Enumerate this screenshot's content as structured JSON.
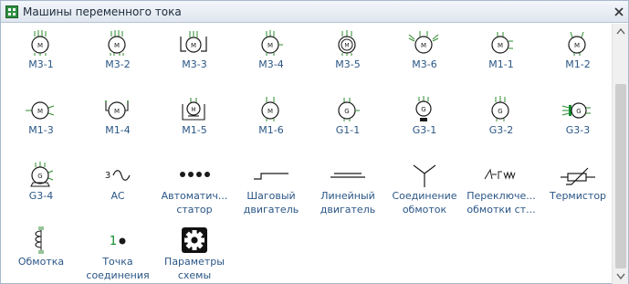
{
  "window": {
    "title": "Машины переменного тока"
  },
  "icons": {
    "title": "stencil-grid-icon",
    "close": "close-x-icon"
  },
  "colors": {
    "label": "#2a5686",
    "symbol_line": "#1a1a1a",
    "symbol_terminal": "#2e8b2e",
    "symbol_accent": "#0a8a2a"
  },
  "items": [
    {
      "label": "M3-1",
      "icon": "motor-3phase-icon"
    },
    {
      "label": "M3-2",
      "icon": "motor-3phase-icon"
    },
    {
      "label": "M3-3",
      "icon": "motor-3phase-brushes-icon"
    },
    {
      "label": "M3-4",
      "icon": "motor-3phase-icon"
    },
    {
      "label": "M3-5",
      "icon": "motor-3phase-icon"
    },
    {
      "label": "M3-6",
      "icon": "motor-3phase-icon"
    },
    {
      "label": "M1-1",
      "icon": "motor-1phase-icon"
    },
    {
      "label": "M1-2",
      "icon": "motor-1phase-icon"
    },
    {
      "label": "M1-3",
      "icon": "motor-1phase-icon"
    },
    {
      "label": "M1-4",
      "icon": "motor-1phase-icon"
    },
    {
      "label": "M1-5",
      "icon": "motor-1phase-icon"
    },
    {
      "label": "M1-6",
      "icon": "motor-1phase-icon"
    },
    {
      "label": "G1-1",
      "icon": "generator-1phase-icon"
    },
    {
      "label": "G3-1",
      "icon": "generator-3phase-icon"
    },
    {
      "label": "G3-2",
      "icon": "generator-3phase-icon"
    },
    {
      "label": "G3-3",
      "icon": "generator-3phase-icon"
    },
    {
      "label": "G3-4",
      "icon": "generator-3phase-icon"
    },
    {
      "label": "AC",
      "icon": "ac-wave-icon"
    },
    {
      "label": "Автоматич...\nстатор",
      "icon": "stator-dots-icon"
    },
    {
      "label": "Шаговый\nдвигатель",
      "icon": "stepper-line-icon"
    },
    {
      "label": "Линейный\nдвигатель",
      "icon": "linear-motor-icon"
    },
    {
      "label": "Соединение\nобмоток",
      "icon": "star-connection-icon"
    },
    {
      "label": "Переключе...\nобмотки ст...",
      "icon": "winding-switch-icon"
    },
    {
      "label": "Термистор",
      "icon": "thermistor-icon"
    },
    {
      "label": "Обмотка",
      "icon": "winding-coil-icon"
    },
    {
      "label": "Точка\nсоединения",
      "icon": "connection-point-icon"
    },
    {
      "label": "Параметры\nсхемы",
      "icon": "gear-icon"
    }
  ],
  "symbol_text": {
    "ac_prefix": "3",
    "connection_point_number": "1"
  }
}
